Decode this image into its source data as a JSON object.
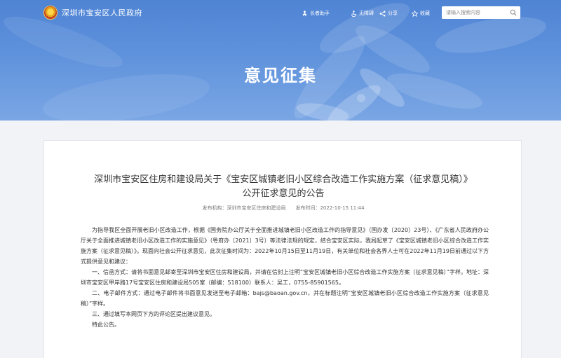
{
  "header": {
    "site_name": "深圳市宝安区人民政府",
    "tools": {
      "elder_mode": "长者助手",
      "accessibility": "无障碍",
      "share": "分享",
      "favorite": "收藏"
    },
    "search": {
      "placeholder": "请输入搜索内容"
    }
  },
  "banner": {
    "title": "意见征集"
  },
  "article": {
    "title": "深圳市宝安区住房和建设局关于《宝安区城镇老旧小区综合改造工作实施方案（征求意见稿）》公开征求意见的公告",
    "publisher": "发布机构：深圳市宝安区住房和建设局",
    "publish_time": "发布时间：2022-10-15 11:44",
    "paragraphs": [
      "为指导我区全面开展老旧小区改造工作，根据《国务院办公厅关于全面推进城镇老旧小区改造工作的指导意见》（国办发〔2020〕23号）、《广东省人民政府办公厅关于全面推进城镇老旧小区改造工作的实施意见》（粤府办〔2021〕3号）等法律法规的规定，结合宝安区实际，我局起草了《宝安区城镇老旧小区综合改造工作实施方案（征求意见稿）》。现面向社会公开征求意见，此次征集时间为：2022年10月15日至11月19日，有关单位和社会各界人士可在2022年11月19日前通过以下方式提供意见和建议：",
      "一、信函方式：请将书面意见邮寄至深圳市宝安区住房和建设局，并请在信封上注明“宝安区城镇老旧小区综合改造工作实施方案（征求意见稿）”字样。地址：深圳市宝安区甲岸路17号宝安区住房和建设局505室（邮编：518100）联系人：吴工，0755-85901565。",
      "二、电子邮件方式：通过电子邮件将书面意见发送至电子邮箱：bajs@baoan.gov.cn，并在标题注明“宝安区城镇老旧小区综合改造工作实施方案（征求意见稿）”字样。",
      "三、通过填写本网页下方的评论区提出建议意见。",
      "特此公告。"
    ]
  },
  "colors": {
    "banner": "#5f92dc",
    "background": "#f1f3f6",
    "card": "#ffffff"
  },
  "icons": [
    "emblem-logo",
    "elder-icon",
    "accessibility-icon",
    "share-icon",
    "star-icon",
    "search-icon"
  ]
}
